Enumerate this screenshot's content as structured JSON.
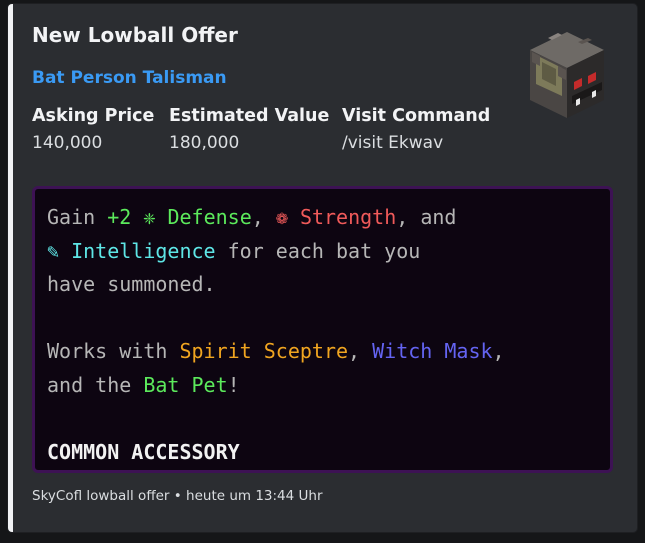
{
  "embed": {
    "title": "New Lowball Offer",
    "item_name": "Bat Person Talisman",
    "fields": [
      {
        "name": "Asking Price",
        "value": "140,000"
      },
      {
        "name": "Estimated Value",
        "value": "180,000"
      },
      {
        "name": "Visit Command",
        "value": "/visit Ekwav"
      }
    ],
    "thumbnail_icon": "bat-person-head-icon",
    "accent_color": "#f2f3f5",
    "lore": {
      "gain": "Gain ",
      "defense_amount": "+2",
      "defense_icon": "❈",
      "defense_label": "Defense",
      "comma1": ", ",
      "strength_icon": "❁",
      "strength_label": "Strength",
      "and1": ", and",
      "intel_icon": "✎",
      "intel_label": "Intelligence",
      "rest1": " for each bat you",
      "line3": "have summoned.",
      "works_with": "Works with ",
      "spirit_sceptre": "Spirit Sceptre",
      "comma2": ", ",
      "witch_mask": "Witch Mask",
      "comma3": ",",
      "and_the": "and the ",
      "bat_pet": "Bat Pet",
      "exclaim": "!",
      "rarity": "COMMON ACCESSORY"
    },
    "footer": "SkyCofl lowball offer • heute um 13:44 Uhr"
  }
}
